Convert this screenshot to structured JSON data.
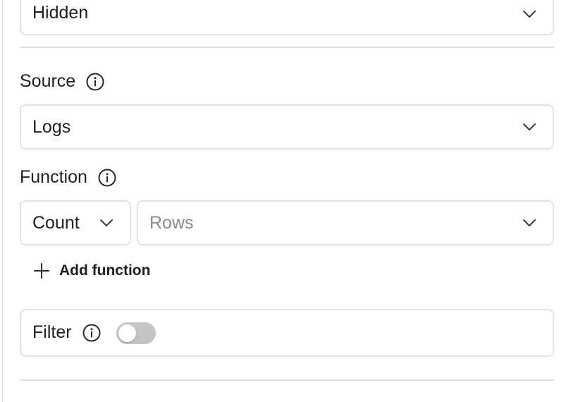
{
  "visibility_select": {
    "value": "Hidden",
    "icon": "chevron-down-icon"
  },
  "source": {
    "label": "Source",
    "info_icon": "info-icon",
    "select_value": "Logs"
  },
  "function": {
    "label": "Function",
    "info_icon": "info-icon",
    "aggregate_value": "Count",
    "field_placeholder": "Rows",
    "add_label": "Add function",
    "add_icon": "plus-icon"
  },
  "filter": {
    "label": "Filter",
    "info_icon": "info-icon",
    "enabled": false
  },
  "colors": {
    "border": "#e2e2e2",
    "text": "#1f1f1f",
    "placeholder": "#8c8c8c",
    "toggle_off": "#c4c4c4"
  }
}
